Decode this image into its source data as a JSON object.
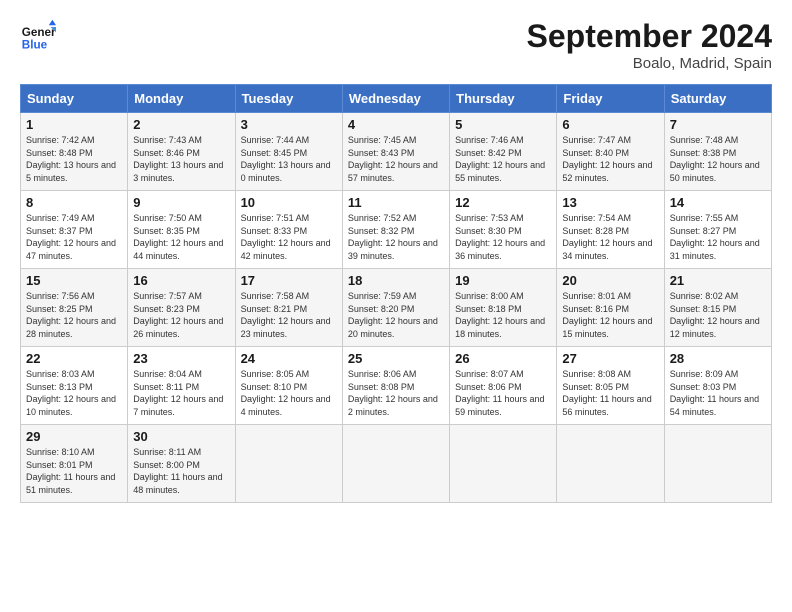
{
  "header": {
    "logo_text_general": "General",
    "logo_text_blue": "Blue",
    "month_title": "September 2024",
    "location": "Boalo, Madrid, Spain"
  },
  "calendar": {
    "days_of_week": [
      "Sunday",
      "Monday",
      "Tuesday",
      "Wednesday",
      "Thursday",
      "Friday",
      "Saturday"
    ],
    "weeks": [
      [
        {
          "day": "",
          "info": ""
        },
        {
          "day": "",
          "info": ""
        },
        {
          "day": "",
          "info": ""
        },
        {
          "day": "",
          "info": ""
        },
        {
          "day": "",
          "info": ""
        },
        {
          "day": "",
          "info": ""
        },
        {
          "day": "",
          "info": ""
        }
      ]
    ],
    "cells": [
      {
        "day": "1",
        "sunrise": "Sunrise: 7:42 AM",
        "sunset": "Sunset: 8:48 PM",
        "daylight": "Daylight: 13 hours and 5 minutes."
      },
      {
        "day": "2",
        "sunrise": "Sunrise: 7:43 AM",
        "sunset": "Sunset: 8:46 PM",
        "daylight": "Daylight: 13 hours and 3 minutes."
      },
      {
        "day": "3",
        "sunrise": "Sunrise: 7:44 AM",
        "sunset": "Sunset: 8:45 PM",
        "daylight": "Daylight: 13 hours and 0 minutes."
      },
      {
        "day": "4",
        "sunrise": "Sunrise: 7:45 AM",
        "sunset": "Sunset: 8:43 PM",
        "daylight": "Daylight: 12 hours and 57 minutes."
      },
      {
        "day": "5",
        "sunrise": "Sunrise: 7:46 AM",
        "sunset": "Sunset: 8:42 PM",
        "daylight": "Daylight: 12 hours and 55 minutes."
      },
      {
        "day": "6",
        "sunrise": "Sunrise: 7:47 AM",
        "sunset": "Sunset: 8:40 PM",
        "daylight": "Daylight: 12 hours and 52 minutes."
      },
      {
        "day": "7",
        "sunrise": "Sunrise: 7:48 AM",
        "sunset": "Sunset: 8:38 PM",
        "daylight": "Daylight: 12 hours and 50 minutes."
      },
      {
        "day": "8",
        "sunrise": "Sunrise: 7:49 AM",
        "sunset": "Sunset: 8:37 PM",
        "daylight": "Daylight: 12 hours and 47 minutes."
      },
      {
        "day": "9",
        "sunrise": "Sunrise: 7:50 AM",
        "sunset": "Sunset: 8:35 PM",
        "daylight": "Daylight: 12 hours and 44 minutes."
      },
      {
        "day": "10",
        "sunrise": "Sunrise: 7:51 AM",
        "sunset": "Sunset: 8:33 PM",
        "daylight": "Daylight: 12 hours and 42 minutes."
      },
      {
        "day": "11",
        "sunrise": "Sunrise: 7:52 AM",
        "sunset": "Sunset: 8:32 PM",
        "daylight": "Daylight: 12 hours and 39 minutes."
      },
      {
        "day": "12",
        "sunrise": "Sunrise: 7:53 AM",
        "sunset": "Sunset: 8:30 PM",
        "daylight": "Daylight: 12 hours and 36 minutes."
      },
      {
        "day": "13",
        "sunrise": "Sunrise: 7:54 AM",
        "sunset": "Sunset: 8:28 PM",
        "daylight": "Daylight: 12 hours and 34 minutes."
      },
      {
        "day": "14",
        "sunrise": "Sunrise: 7:55 AM",
        "sunset": "Sunset: 8:27 PM",
        "daylight": "Daylight: 12 hours and 31 minutes."
      },
      {
        "day": "15",
        "sunrise": "Sunrise: 7:56 AM",
        "sunset": "Sunset: 8:25 PM",
        "daylight": "Daylight: 12 hours and 28 minutes."
      },
      {
        "day": "16",
        "sunrise": "Sunrise: 7:57 AM",
        "sunset": "Sunset: 8:23 PM",
        "daylight": "Daylight: 12 hours and 26 minutes."
      },
      {
        "day": "17",
        "sunrise": "Sunrise: 7:58 AM",
        "sunset": "Sunset: 8:21 PM",
        "daylight": "Daylight: 12 hours and 23 minutes."
      },
      {
        "day": "18",
        "sunrise": "Sunrise: 7:59 AM",
        "sunset": "Sunset: 8:20 PM",
        "daylight": "Daylight: 12 hours and 20 minutes."
      },
      {
        "day": "19",
        "sunrise": "Sunrise: 8:00 AM",
        "sunset": "Sunset: 8:18 PM",
        "daylight": "Daylight: 12 hours and 18 minutes."
      },
      {
        "day": "20",
        "sunrise": "Sunrise: 8:01 AM",
        "sunset": "Sunset: 8:16 PM",
        "daylight": "Daylight: 12 hours and 15 minutes."
      },
      {
        "day": "21",
        "sunrise": "Sunrise: 8:02 AM",
        "sunset": "Sunset: 8:15 PM",
        "daylight": "Daylight: 12 hours and 12 minutes."
      },
      {
        "day": "22",
        "sunrise": "Sunrise: 8:03 AM",
        "sunset": "Sunset: 8:13 PM",
        "daylight": "Daylight: 12 hours and 10 minutes."
      },
      {
        "day": "23",
        "sunrise": "Sunrise: 8:04 AM",
        "sunset": "Sunset: 8:11 PM",
        "daylight": "Daylight: 12 hours and 7 minutes."
      },
      {
        "day": "24",
        "sunrise": "Sunrise: 8:05 AM",
        "sunset": "Sunset: 8:10 PM",
        "daylight": "Daylight: 12 hours and 4 minutes."
      },
      {
        "day": "25",
        "sunrise": "Sunrise: 8:06 AM",
        "sunset": "Sunset: 8:08 PM",
        "daylight": "Daylight: 12 hours and 2 minutes."
      },
      {
        "day": "26",
        "sunrise": "Sunrise: 8:07 AM",
        "sunset": "Sunset: 8:06 PM",
        "daylight": "Daylight: 11 hours and 59 minutes."
      },
      {
        "day": "27",
        "sunrise": "Sunrise: 8:08 AM",
        "sunset": "Sunset: 8:05 PM",
        "daylight": "Daylight: 11 hours and 56 minutes."
      },
      {
        "day": "28",
        "sunrise": "Sunrise: 8:09 AM",
        "sunset": "Sunset: 8:03 PM",
        "daylight": "Daylight: 11 hours and 54 minutes."
      },
      {
        "day": "29",
        "sunrise": "Sunrise: 8:10 AM",
        "sunset": "Sunset: 8:01 PM",
        "daylight": "Daylight: 11 hours and 51 minutes."
      },
      {
        "day": "30",
        "sunrise": "Sunrise: 8:11 AM",
        "sunset": "Sunset: 8:00 PM",
        "daylight": "Daylight: 11 hours and 48 minutes."
      }
    ]
  }
}
